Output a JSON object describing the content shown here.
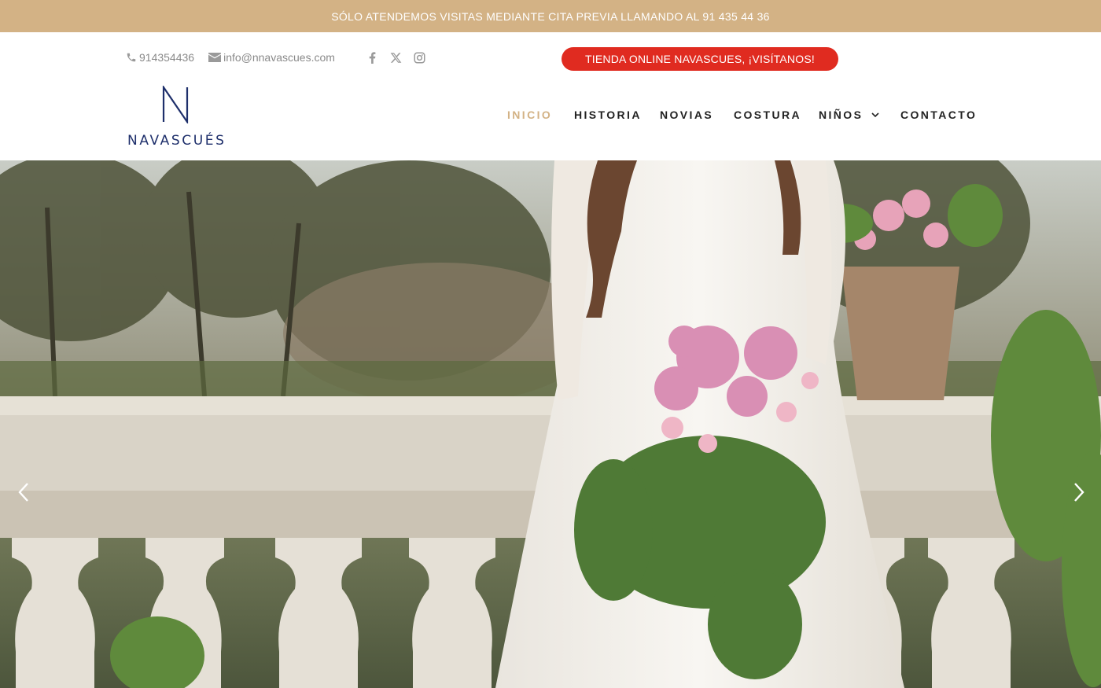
{
  "announcement": {
    "text": "SÓLO ATENDEMOS VISITAS MEDIANTE CITA PREVIA LLAMANDO AL 91 435 44 36"
  },
  "topbar": {
    "phone": "914354436",
    "email": "info@nnavascues.com",
    "social": [
      {
        "name": "facebook-icon"
      },
      {
        "name": "x-twitter-icon"
      },
      {
        "name": "instagram-icon"
      }
    ],
    "shop_button": "TIENDA ONLINE NAVASCUES, ¡VISÍTANOS!"
  },
  "header": {
    "logo": {
      "letter": "N",
      "word": "NAVASCUÉS"
    },
    "nav": [
      {
        "label": "INICIO",
        "active": true
      },
      {
        "label": "HISTORIA",
        "active": false
      },
      {
        "label": "NOVIAS",
        "active": false
      },
      {
        "label": "COSTURA",
        "active": false
      },
      {
        "label": "NIÑOS",
        "active": false,
        "has_dropdown": true
      },
      {
        "label": "CONTACTO",
        "active": false
      }
    ]
  },
  "hero": {
    "image_description_icon": "bride-photo",
    "prev_icon": "chevron-left-icon",
    "next_icon": "chevron-right-icon"
  },
  "colors": {
    "announcement_bg": "#d3b285",
    "accent": "#d3b285",
    "shop_button_bg": "#e02b20",
    "logo": "#1e2f6b"
  }
}
